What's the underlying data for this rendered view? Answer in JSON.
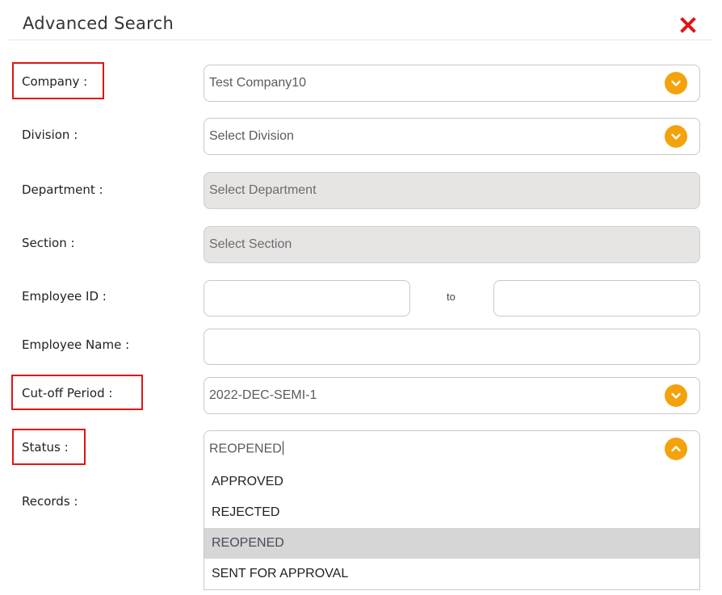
{
  "header": {
    "title": "Advanced Search",
    "close_icon": "close-x-icon",
    "close_color": "#e01515"
  },
  "labels": {
    "company": "Company :",
    "division": "Division :",
    "department": "Department :",
    "section": "Section :",
    "employee_id": "Employee ID :",
    "employee_name": "Employee Name :",
    "cutoff_period": "Cut-off Period :",
    "status": "Status :",
    "records": "Records :"
  },
  "fields": {
    "company": {
      "value": "Test Company10"
    },
    "division": {
      "placeholder": "Select Division"
    },
    "department": {
      "placeholder": "Select Department"
    },
    "section": {
      "placeholder": "Select Section"
    },
    "employee_id_from": {
      "value": ""
    },
    "employee_id_to": {
      "value": ""
    },
    "employee_id_separator": "to",
    "employee_name": {
      "value": ""
    },
    "cutoff_period": {
      "value": "2022-DEC-SEMI-1"
    },
    "status": {
      "value": "REOPENED"
    }
  },
  "status_dropdown": {
    "options": [
      "APPROVED",
      "REJECTED",
      "REOPENED",
      "SENT FOR APPROVAL"
    ],
    "selected": "REOPENED"
  },
  "colors": {
    "accent": "#f4a20c",
    "highlight_border": "#e01515",
    "disabled_bg": "#e7e4e4",
    "selected_option_bg": "#d6d6d6"
  },
  "icons": {
    "chevron_down": "chevron-down-icon",
    "chevron_up": "chevron-up-icon"
  }
}
